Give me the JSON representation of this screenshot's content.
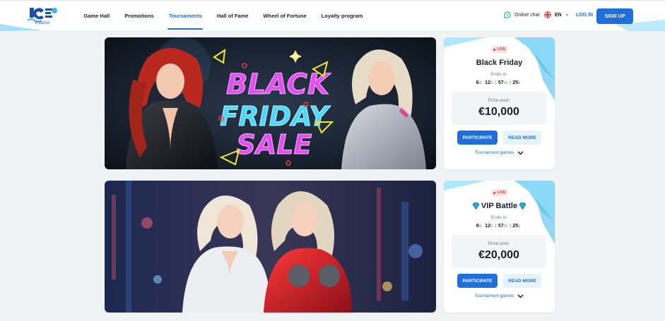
{
  "header": {
    "logo_text": "ICE Casino",
    "nav": [
      {
        "label": "Game Hall",
        "active": false
      },
      {
        "label": "Promotions",
        "active": false
      },
      {
        "label": "Tournaments",
        "active": true
      },
      {
        "label": "Hall of Fame",
        "active": false
      },
      {
        "label": "Wheel of Fortune",
        "active": false
      },
      {
        "label": "Loyalty program",
        "active": false
      }
    ],
    "online_chat": "Online chat",
    "language": "EN",
    "login": "LOG IN",
    "signup": "SIGN UP"
  },
  "banners": [
    {
      "text_lines": [
        "BLACK",
        "FRIDAY",
        "SALE"
      ]
    },
    {
      "text_lines": []
    }
  ],
  "tournaments": [
    {
      "live_badge": "LIVE",
      "title": "Black Friday",
      "ends_label": "Ends in:",
      "countdown": {
        "d": "6",
        "d_unit": "d",
        "h": "12",
        "h_unit": "h",
        "m": "57",
        "m_unit": "m",
        "s": "25",
        "s_unit": "s"
      },
      "prize_label": "Prize pool:",
      "prize_value": "€10,000",
      "participate": "PARTICIPATE",
      "read_more": "READ MORE",
      "games_link": "Tournament games"
    },
    {
      "live_badge": "LIVE",
      "title": "VIP Battle",
      "ends_label": "Ends in:",
      "countdown": {
        "d": "9",
        "d_unit": "d",
        "h": "12",
        "h_unit": "h",
        "m": "57",
        "m_unit": "m",
        "s": "25",
        "s_unit": "s"
      },
      "prize_label": "Prize pool:",
      "prize_value": "€20,000",
      "participate": "PARTICIPATE",
      "read_more": "READ MORE",
      "games_link": "Tournament games"
    }
  ],
  "colors": {
    "accent": "#1e6fd9",
    "live_red": "#e0394b",
    "ice_blue": "#6fd0f5"
  }
}
